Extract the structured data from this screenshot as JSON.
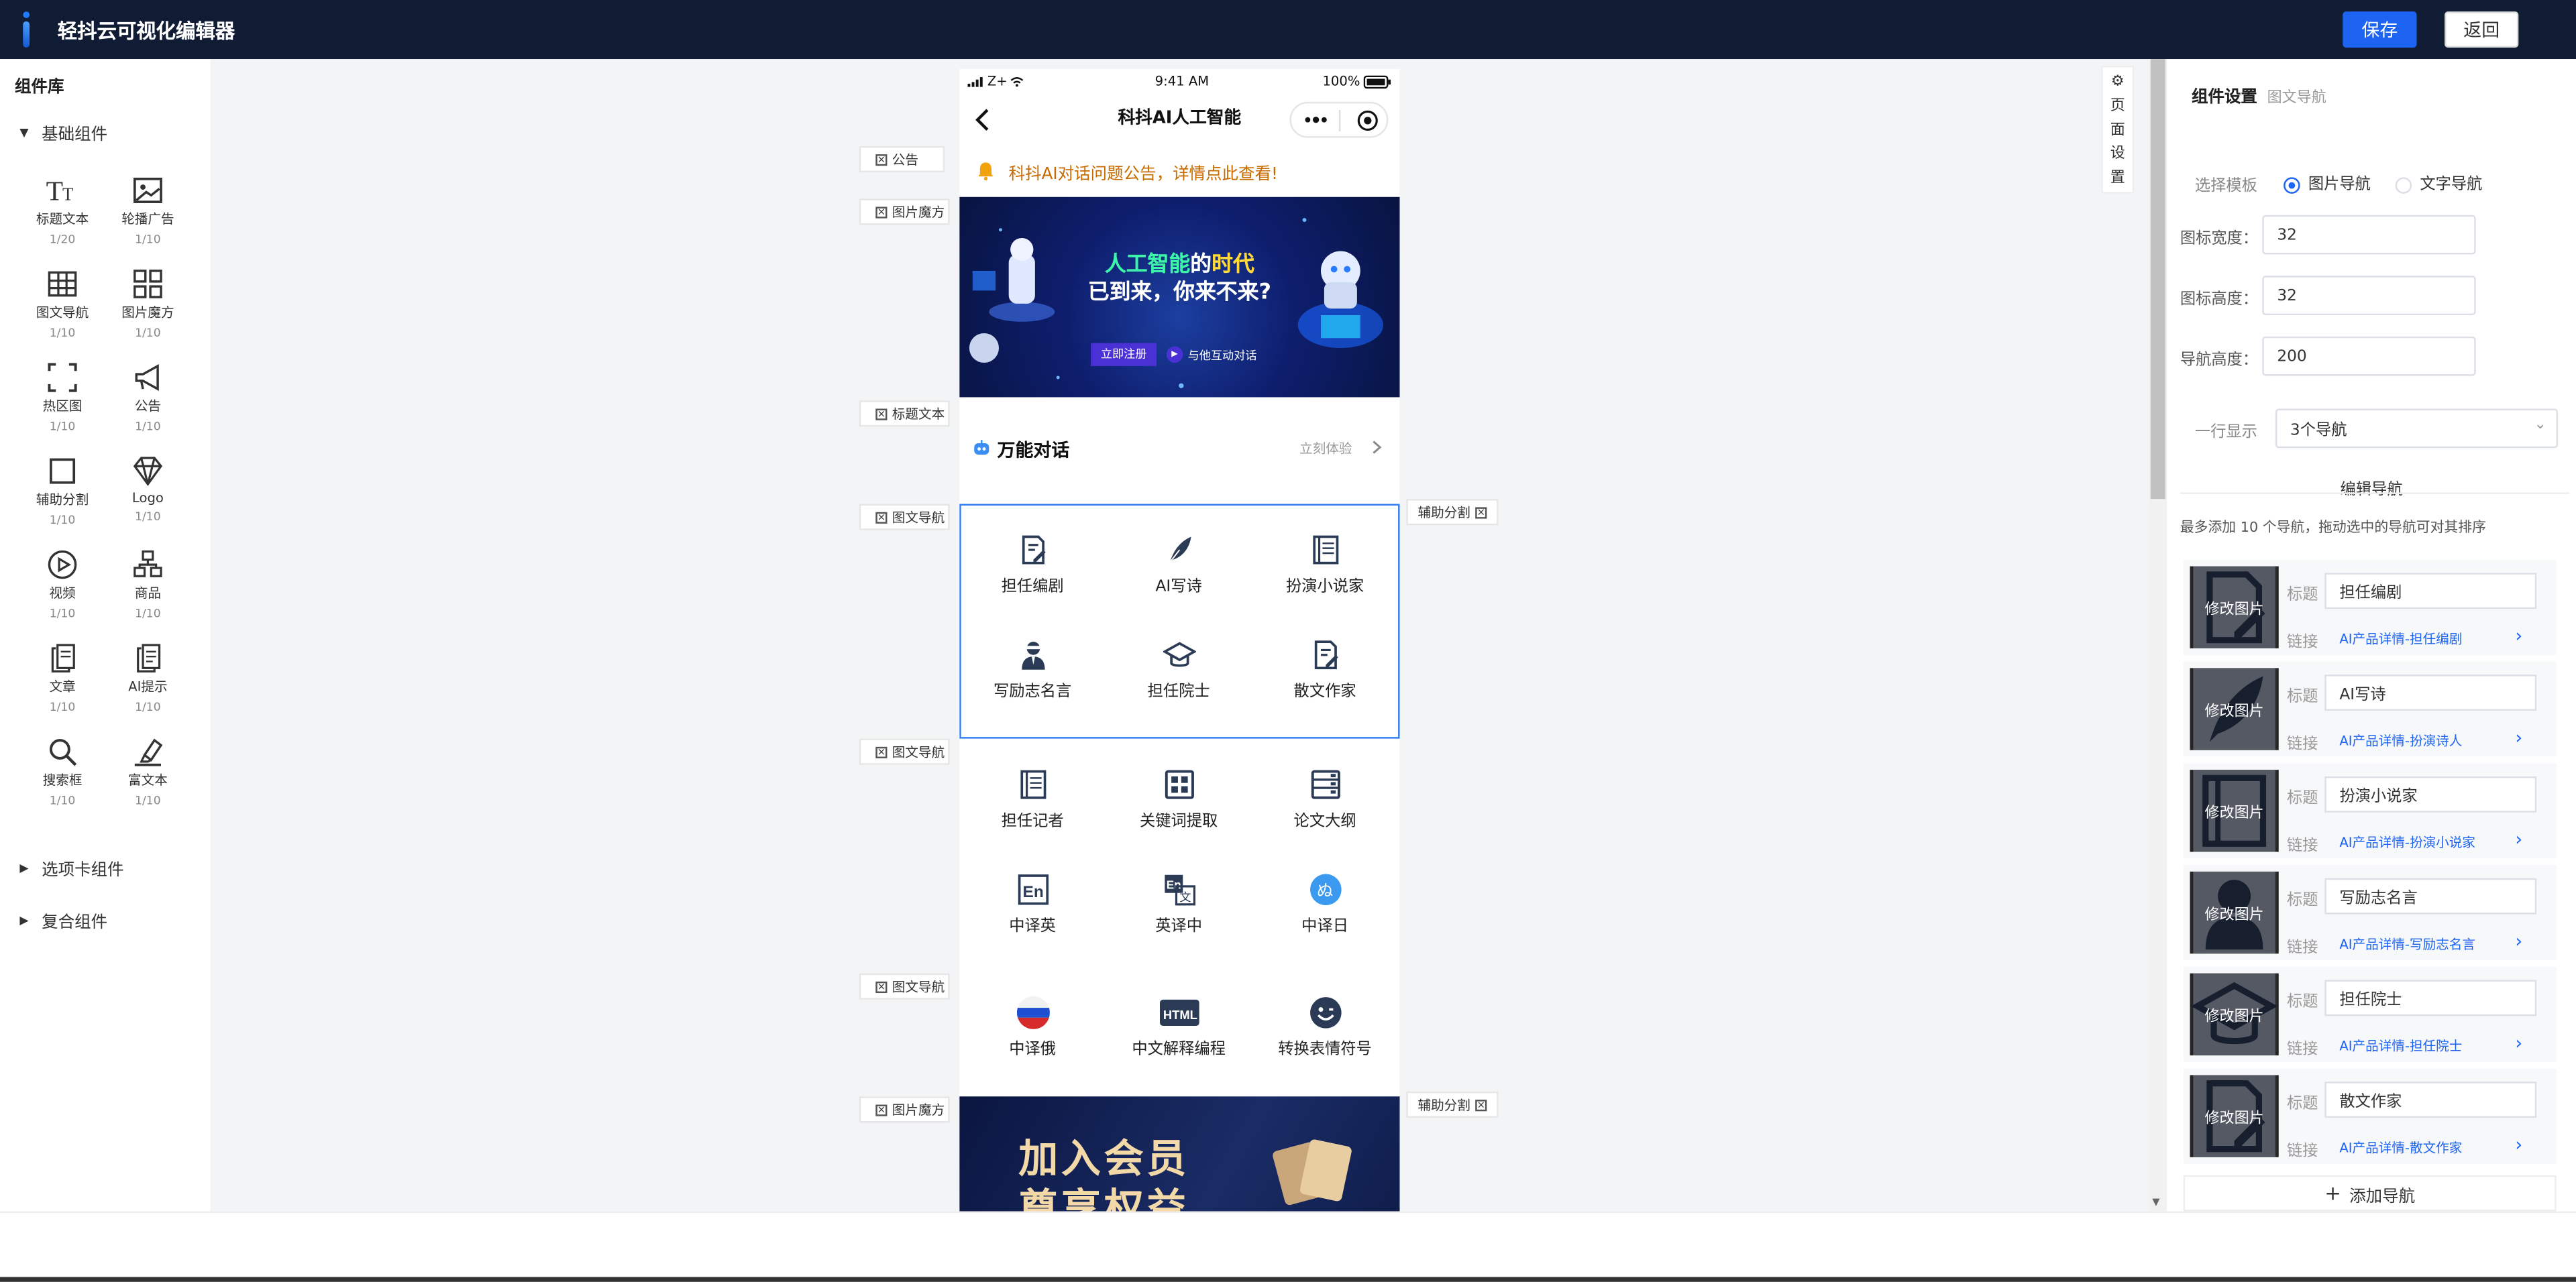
{
  "app": {
    "title": "轻抖云可视化编辑器",
    "save": "保存",
    "back": "返回"
  },
  "left": {
    "title": "组件库",
    "basic_group": "基础组件",
    "components": [
      {
        "name": "标题文本",
        "count": "1/20"
      },
      {
        "name": "轮播广告",
        "count": "1/10"
      },
      {
        "name": "图文导航",
        "count": "1/10"
      },
      {
        "name": "图片魔方",
        "count": "1/10"
      },
      {
        "name": "热区图",
        "count": "1/10"
      },
      {
        "name": "公告",
        "count": "1/10"
      },
      {
        "name": "辅助分割",
        "count": "1/10"
      },
      {
        "name": "Logo",
        "count": "1/10"
      },
      {
        "name": "视频",
        "count": "1/10"
      },
      {
        "name": "商品",
        "count": "1/10"
      },
      {
        "name": "文章",
        "count": "1/10"
      },
      {
        "name": "AI提示",
        "count": "1/10"
      },
      {
        "name": "搜索框",
        "count": "1/10"
      },
      {
        "name": "富文本",
        "count": "1/10"
      }
    ],
    "tab_group": "选项卡组件",
    "composite_group": "复合组件"
  },
  "tags": {
    "notice": "公告",
    "cube1": "图片魔方",
    "title_text": "标题文本",
    "nav1": "图文导航",
    "nav2": "图文导航",
    "nav3": "图文导航",
    "cube2": "图片魔方",
    "divider1": "辅助分割",
    "divider2": "辅助分割"
  },
  "phone": {
    "carrier": "Z+",
    "time": "9:41 AM",
    "battery": "100%",
    "page_title": "科抖AI人工智能",
    "notice": "科抖AI对话问题公告，详情点此查看!",
    "banner": {
      "line1_a": "人工智能",
      "line1_b": "的",
      "line1_c": "时代",
      "line2": "已到来，你来不来?",
      "btn": "立即注册",
      "sub": "与他互动对话"
    },
    "section_title": "万能对话",
    "section_more": "立刻体验",
    "nav_a": [
      "担任编剧",
      "AI写诗",
      "扮演小说家",
      "写励志名言",
      "担任院士",
      "散文作家"
    ],
    "nav_b": [
      "担任记者",
      "关键词提取",
      "论文大纲",
      "中译英",
      "英译中",
      "中译日",
      "中译俄",
      "中文解释编程",
      "转换表情符号"
    ],
    "member_line1": "加入会员",
    "member_line2": "尊享权益"
  },
  "page_settings": "页面设置",
  "right": {
    "tab_active": "组件设置",
    "tab_sub": "图文导航",
    "template_label": "选择模板",
    "template_opt1": "图片导航",
    "template_opt2": "文字导航",
    "icon_width_label": "图标宽度：",
    "icon_width": "32",
    "icon_height_label": "图标高度：",
    "icon_height": "32",
    "nav_height_label": "导航高度：",
    "nav_height": "200",
    "row_label": "一行显示",
    "row_value": "3个导航",
    "edit_title": "编辑导航",
    "hint": "最多添加 10 个导航，拖动选中的导航可对其排序",
    "title_lbl": "标题",
    "link_lbl": "链接",
    "change_img": "修改图片",
    "items": [
      {
        "title": "担任编剧",
        "link": "AI产品详情-担任编剧"
      },
      {
        "title": "AI写诗",
        "link": "AI产品详情-扮演诗人"
      },
      {
        "title": "扮演小说家",
        "link": "AI产品详情-扮演小说家"
      },
      {
        "title": "写励志名言",
        "link": "AI产品详情-写励志名言"
      },
      {
        "title": "担任院士",
        "link": "AI产品详情-担任院士"
      },
      {
        "title": "散文作家",
        "link": "AI产品详情-散文作家"
      }
    ],
    "add_nav": "添加导航"
  },
  "colors": {
    "topbar": "#0f1c33",
    "accent": "#1d64f2",
    "selection": "#2f7cf6"
  }
}
